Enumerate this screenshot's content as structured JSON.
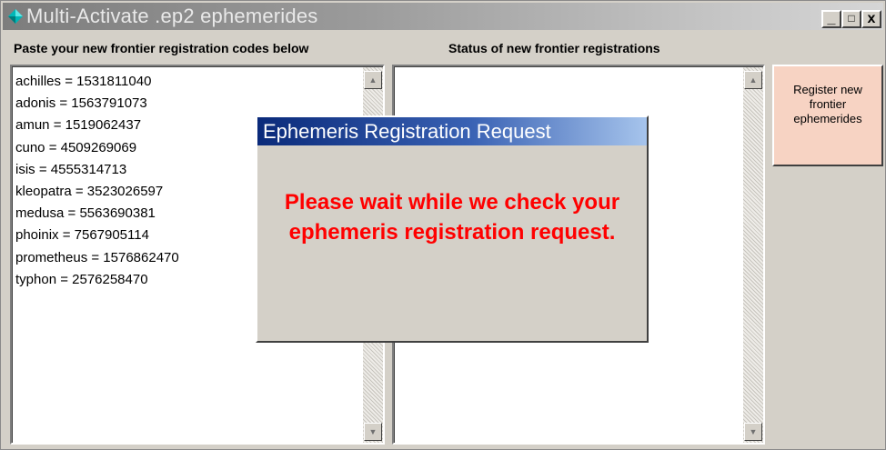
{
  "window": {
    "title": "Multi-Activate .ep2 ephemerides",
    "controls": {
      "minimize": "_",
      "maximize": "□",
      "close": "x"
    }
  },
  "left_panel": {
    "label": "Paste your new frontier registration codes below",
    "codes": [
      "achilles = 1531811040",
      "adonis = 1563791073",
      "amun = 1519062437",
      "cuno = 4509269069",
      "isis = 4555314713",
      "kleopatra = 3523026597",
      "medusa = 5563690381",
      "phoinix = 7567905114",
      "prometheus = 1576862470",
      "typhon = 2576258470"
    ]
  },
  "right_panel": {
    "label": "Status of new frontier registrations"
  },
  "register_button": {
    "label": "Register new frontier ephemerides"
  },
  "dialog": {
    "title": "Ephemeris Registration Request",
    "message": "Please wait while we check your ephemeris registration request."
  },
  "colors": {
    "message": "#ff0000",
    "register_button_bg": "#f7d3c3",
    "dialog_title_bg": "#0a2a7a",
    "app_icon": "#00b7b7"
  },
  "icons": {
    "app": "diamond-icon",
    "scroll_up": "arrow-up-icon",
    "scroll_down": "arrow-down-icon"
  }
}
